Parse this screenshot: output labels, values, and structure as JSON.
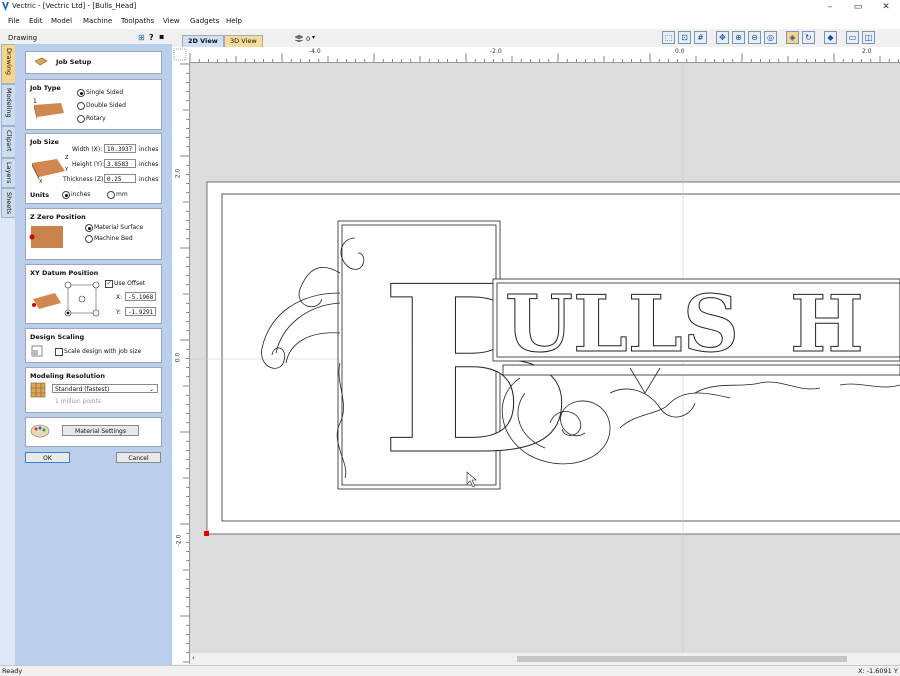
{
  "window": {
    "title": "Vectric - [Vectric Ltd] - [Bulls_Head]"
  },
  "menu": [
    "File",
    "Edit",
    "Model",
    "Machine",
    "Toolpaths",
    "View",
    "Gadgets",
    "Help"
  ],
  "panel": {
    "title": "Drawing",
    "help_glyph": "?",
    "pin_glyph": "⊞",
    "vertical_tabs": [
      "Drawing",
      "Modeling",
      "Clipart",
      "Layers",
      "Sheets"
    ],
    "job_setup": {
      "title": "Job Setup"
    },
    "job_type": {
      "title": "Job Type",
      "options": [
        "Single Sided",
        "Double Sided",
        "Rotary"
      ],
      "selected": "Single Sided"
    },
    "job_size": {
      "title": "Job Size",
      "width_label": "Width (X):",
      "width_value": "10.3937",
      "width_unit": "inches",
      "height_label": "Height (Y):",
      "height_value": "3.8583",
      "height_unit": "inches",
      "thickness_label": "Thickness (Z):",
      "thickness_value": "0.25",
      "thickness_unit": "inches",
      "units_label": "Units",
      "unit_options": [
        "inches",
        "mm"
      ],
      "unit_selected": "inches"
    },
    "z_zero": {
      "title": "Z Zero Position",
      "options": [
        "Material Surface",
        "Machine Bed"
      ],
      "selected": "Material Surface"
    },
    "xy_datum": {
      "title": "XY Datum Position",
      "use_offset_label": "Use Offset",
      "use_offset": true,
      "x_label": "X:",
      "x_value": "-5.1968",
      "y_label": "Y:",
      "y_value": "-1.9291"
    },
    "design_scaling": {
      "title": "Design Scaling",
      "checkbox_label": "Scale design with job size",
      "checked": false
    },
    "modeling_resolution": {
      "title": "Modeling Resolution",
      "selected": "Standard (fastest)",
      "note": "1 million points"
    },
    "material_settings_label": "Material Settings",
    "ok_label": "OK",
    "cancel_label": "Cancel"
  },
  "view_tabs": [
    "2D View",
    "3D View"
  ],
  "active_view": "2D View",
  "layer_dropdown": "0",
  "ruler": {
    "top_ticks": [
      "-4.0",
      "-2.0",
      "0.0",
      "2.0"
    ],
    "left_ticks": [
      "2.0",
      "0.0",
      "-2.0"
    ]
  },
  "design_text": [
    "B",
    "ULLS",
    "H"
  ],
  "status": {
    "left": "Ready",
    "right": "X: -1.6091 Y"
  }
}
